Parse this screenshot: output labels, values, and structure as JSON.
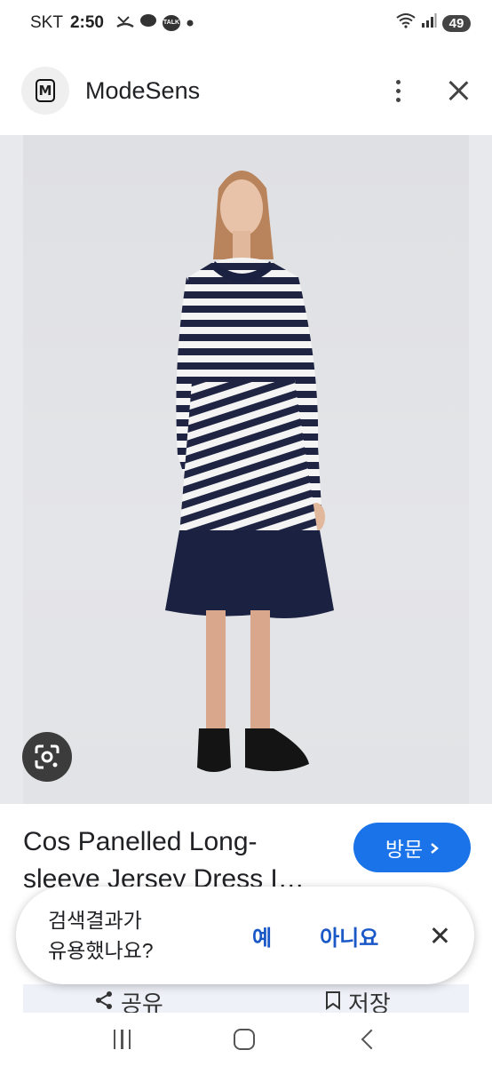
{
  "status_bar": {
    "carrier": "SKT",
    "time": "2:50",
    "talk_badge": "TALK",
    "battery": "49"
  },
  "header": {
    "logo_letter": "M",
    "site_name": "ModeSens"
  },
  "product": {
    "title": "Cos Panelled Long-sleeve Jersey Dress I…",
    "visit_label": "방문"
  },
  "feedback": {
    "question": "검색결과가\n유용했나요?",
    "yes": "예",
    "no": "아니요"
  },
  "actions": {
    "share": "공유",
    "save": "저장"
  },
  "colors": {
    "accent": "#1a73e8",
    "dress_navy": "#1b2140",
    "feedback_link": "#1a57c7"
  }
}
